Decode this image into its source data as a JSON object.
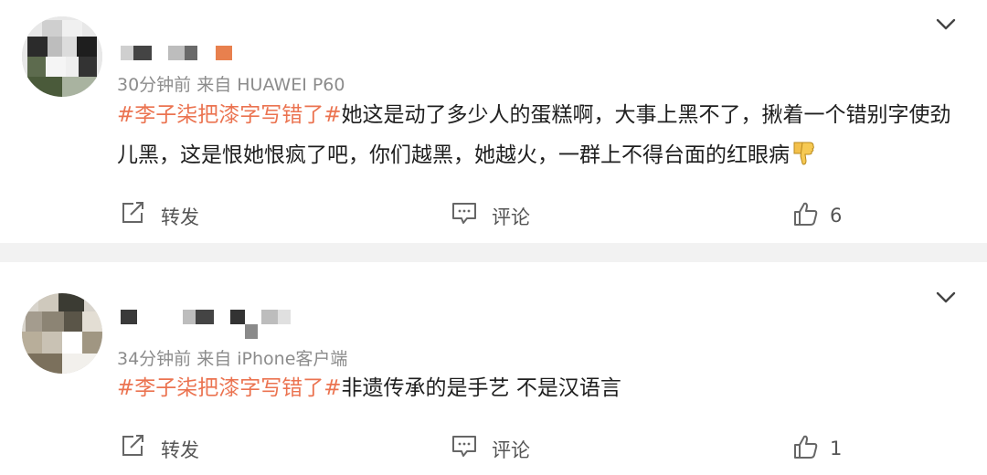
{
  "posts": [
    {
      "id": "post1",
      "meta": "30分钟前  来自 HUAWEI P60",
      "hashtag": "#李子柒把漆字写错了#",
      "body": "她这是动了多少人的蛋糕啊，大事上黑不了，揪着一个错别字使劲儿黑，这是恨她恨疯了吧，你们越黑，她越火，一群上不得台面的红眼病",
      "emoji": "thumbs-down-emoji",
      "actions": {
        "repost": "转发",
        "comment": "评论",
        "like_count": "6"
      }
    },
    {
      "id": "post2",
      "meta": "34分钟前  来自 iPhone客户端",
      "hashtag": "#李子柒把漆字写错了#",
      "body": "非遗传承的是手艺 不是汉语言",
      "actions": {
        "repost": "转发",
        "comment": "评论",
        "like_count": "1"
      }
    }
  ],
  "colors": {
    "hashtag": "#eb7350",
    "meta": "#8c8c8c",
    "divider": "#f2f2f2"
  },
  "icons": [
    "repost-icon",
    "comment-icon",
    "like-icon",
    "chevron-down-icon",
    "thumbs-down-emoji"
  ]
}
